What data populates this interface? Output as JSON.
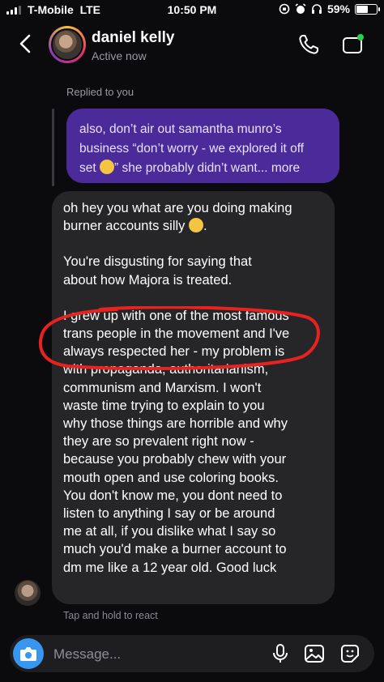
{
  "status_bar": {
    "carrier": "T-Mobile",
    "network": "LTE",
    "time": "10:50 PM",
    "battery": "59%",
    "battery_level": 0.59
  },
  "header": {
    "contact_name": "daniel kelly",
    "presence": "Active now",
    "icons": [
      "back-chevron-icon",
      "phone-icon",
      "video-call-icon"
    ]
  },
  "reply_context": {
    "label": "Replied to you",
    "quoted_line1": "also, don’t air out samantha munro’s",
    "quoted_line2": "business “don’t worry - we explored it off",
    "quoted_line3a": "set",
    "quoted_line3b": "” she probably didn’t want... more"
  },
  "message": {
    "para1_line1": "oh hey you what are you doing making",
    "para1_line2": "burner accounts silly",
    "para1_line2_end": ".",
    "para2_line1": "You're disgusting for saying that",
    "para2_line2": "about how Majora is treated.",
    "para3_lines": [
      "I grew up with one of the most famous",
      "trans people in the movement and I've",
      "always respected her - my problem is",
      "with propaganda, authoritarianism,",
      "communism and Marxism. I won't",
      "waste time trying to explain to you",
      "why those things are horrible and why",
      "they are so prevalent right now -",
      "because you probably chew with your",
      "mouth open and use coloring books.",
      "You don't know me, you dont need to",
      "listen to anything I say or be around",
      "me at all, if you dislike what I say so",
      "much you'd make a burner account to",
      "dm me like a 12 year old. Good luck"
    ],
    "annotation_color": "#e8231f"
  },
  "hint": "Tap and hold to react",
  "composer": {
    "placeholder": "Message...",
    "icons": [
      "camera-icon",
      "microphone-icon",
      "gallery-icon",
      "sticker-icon"
    ],
    "accent": "#3797f0"
  },
  "colors": {
    "background": "#0b0b0d",
    "reply_bubble": "#4b2a9a",
    "message_bubble": "#262628"
  }
}
